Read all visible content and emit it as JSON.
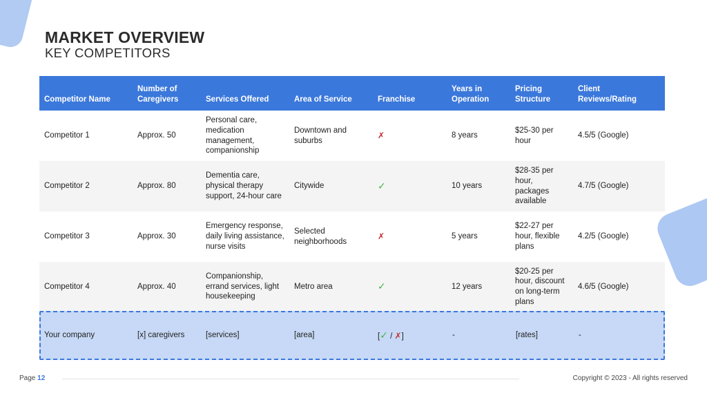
{
  "header": {
    "title": "MARKET OVERVIEW",
    "subtitle": "KEY COMPETITORS"
  },
  "table": {
    "columns": [
      "Competitor Name",
      "Number of Caregivers",
      "Services Offered",
      "Area of Service",
      "Franchise",
      "Years in Operation",
      "Pricing Structure",
      "Client Reviews/Rating"
    ],
    "rows": [
      {
        "name": "Competitor 1",
        "caregivers": "Approx. 50",
        "services": "Personal care, medication management, companionship",
        "area": "Downtown and suburbs",
        "franchise": "✗",
        "years": "8 years",
        "pricing": "$25-30 per hour",
        "rating": "4.5/5 (Google)"
      },
      {
        "name": "Competitor 2",
        "caregivers": "Approx. 80",
        "services": "Dementia care, physical therapy support, 24-hour care",
        "area": "Citywide",
        "franchise": "✓",
        "years": "10 years",
        "pricing": "$28-35 per hour, packages available",
        "rating": "4.7/5 (Google)"
      },
      {
        "name": "Competitor 3",
        "caregivers": "Approx. 30",
        "services": "Emergency response, daily living assistance, nurse visits",
        "area": "Selected neighborhoods",
        "franchise": "✗",
        "years": "5 years",
        "pricing": "$22-27 per hour, flexible plans",
        "rating": "4.2/5 (Google)"
      },
      {
        "name": "Competitor 4",
        "caregivers": "Approx. 40",
        "services": "Companionship, errand services, light housekeeping",
        "area": "Metro area",
        "franchise": "✓",
        "years": "12 years",
        "pricing": "$20-25 per hour, discount on long-term plans",
        "rating": "4.6/5 (Google)"
      }
    ],
    "your_company": {
      "name": "Your company",
      "caregivers": "[x] caregivers",
      "services": "[services]",
      "area": "[area]",
      "franchise_open": "[",
      "franchise_yes": "✓",
      "franchise_sep": " / ",
      "franchise_no": "✗",
      "franchise_close": "]",
      "years": "-",
      "pricing": "[rates]",
      "rating": "-"
    }
  },
  "footer": {
    "page_label": "Page",
    "page_number": "12",
    "copyright": "Copyright © 2023 - All rights reserved"
  },
  "colors": {
    "accent": "#3b78db",
    "highlight": "#c7d9f6",
    "check": "#45b549",
    "cross": "#c42b2b"
  }
}
